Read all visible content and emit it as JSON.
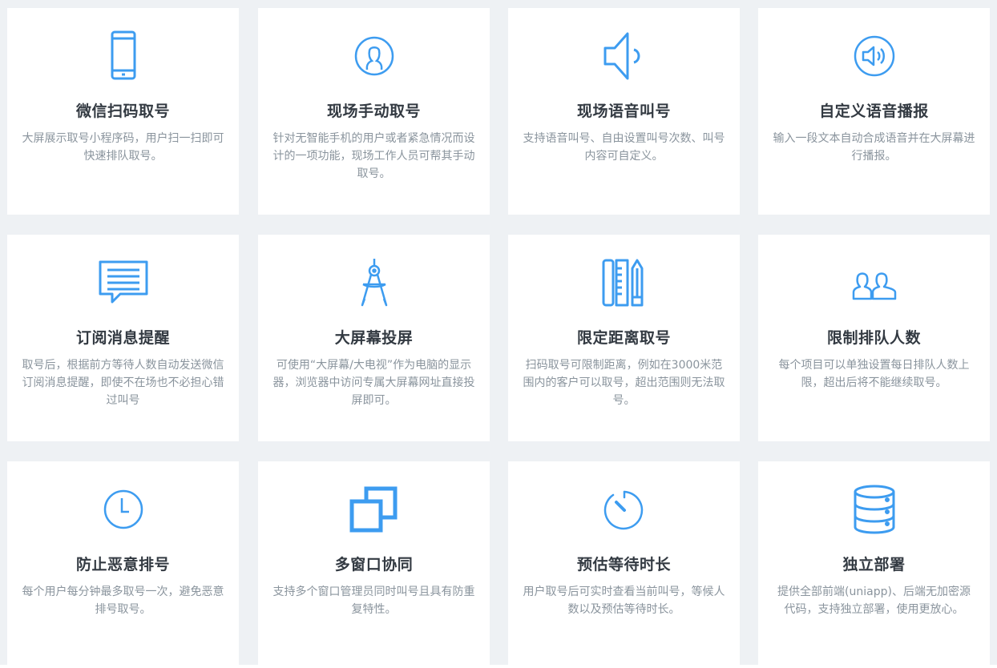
{
  "accent": "#3d9cf0",
  "features": [
    {
      "icon": "mobile-phone-icon",
      "title": "微信扫码取号",
      "desc": "大屏展示取号小程序码，用户扫一扫即可快速排队取号。"
    },
    {
      "icon": "user-circle-icon",
      "title": "现场手动取号",
      "desc": "针对无智能手机的用户或者紧急情况而设计的一项功能，现场工作人员可帮其手动取号。"
    },
    {
      "icon": "speaker-icon",
      "title": "现场语音叫号",
      "desc": "支持语音叫号、自由设置叫号次数、叫号内容可自定义。"
    },
    {
      "icon": "volume-circle-icon",
      "title": "自定义语音播报",
      "desc": "输入一段文本自动合成语音并在大屏幕进行播报。"
    },
    {
      "icon": "chat-message-icon",
      "title": "订阅消息提醒",
      "desc": "取号后，根据前方等待人数自动发送微信订阅消息提醒，即使不在场也不必担心错过叫号"
    },
    {
      "icon": "compass-icon",
      "title": "大屏幕投屏",
      "desc": "可使用“大屏幕/大电视”作为电脑的显示器，浏览器中访问专属大屏幕网址直接投屏即可。"
    },
    {
      "icon": "ruler-pencil-icon",
      "title": "限定距离取号",
      "desc": "扫码取号可限制距离，例如在3000米范围内的客户可以取号，超出范围则无法取号。"
    },
    {
      "icon": "users-icon",
      "title": "限制排队人数",
      "desc": "每个项目可以单独设置每日排队人数上限，超出后将不能继续取号。"
    },
    {
      "icon": "clock-icon",
      "title": "防止恶意排号",
      "desc": "每个用户每分钟最多取号一次，避免恶意排号取号。"
    },
    {
      "icon": "windows-icon",
      "title": "多窗口协同",
      "desc": "支持多个窗口管理员同时叫号且具有防重复特性。"
    },
    {
      "icon": "timer-icon",
      "title": "预估等待时长",
      "desc": "用户取号后可实时查看当前叫号，等候人数以及预估等待时长。"
    },
    {
      "icon": "database-icon",
      "title": "独立部署",
      "desc": "提供全部前端(uniapp)、后端无加密源代码，支持独立部署，使用更放心。"
    }
  ]
}
